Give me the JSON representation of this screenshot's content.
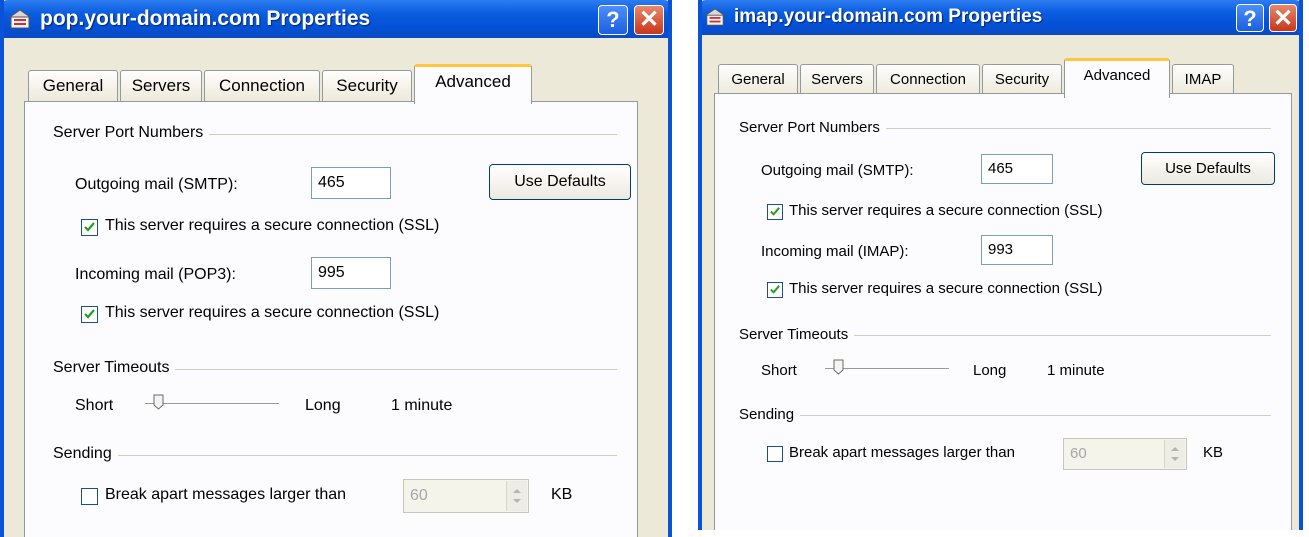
{
  "pop": {
    "title": "pop.your-domain.com Properties",
    "tabs": [
      "General",
      "Servers",
      "Connection",
      "Security",
      "Advanced"
    ],
    "active_tab": "Advanced",
    "ports_group": "Server Port Numbers",
    "outgoing_label": "Outgoing mail (SMTP):",
    "outgoing_value": "465",
    "use_defaults": "Use Defaults",
    "ssl_outgoing_label": "This server requires a secure connection (SSL)",
    "ssl_outgoing_checked": true,
    "incoming_label": "Incoming mail (POP3):",
    "incoming_value": "995",
    "ssl_incoming_label": "This server requires a secure connection (SSL)",
    "ssl_incoming_checked": true,
    "timeouts_group": "Server Timeouts",
    "short_label": "Short",
    "long_label": "Long",
    "timeout_value": "1 minute",
    "sending_group": "Sending",
    "break_label": "Break apart messages larger than",
    "break_checked": false,
    "break_value": "60",
    "kb_label": "KB"
  },
  "imap": {
    "title": "imap.your-domain.com Properties",
    "tabs": [
      "General",
      "Servers",
      "Connection",
      "Security",
      "Advanced",
      "IMAP"
    ],
    "active_tab": "Advanced",
    "ports_group": "Server Port Numbers",
    "outgoing_label": "Outgoing mail (SMTP):",
    "outgoing_value": "465",
    "use_defaults": "Use Defaults",
    "ssl_outgoing_label": "This server requires a secure connection (SSL)",
    "ssl_outgoing_checked": true,
    "incoming_label": "Incoming mail (IMAP):",
    "incoming_value": "993",
    "ssl_incoming_label": "This server requires a secure connection (SSL)",
    "ssl_incoming_checked": true,
    "timeouts_group": "Server Timeouts",
    "short_label": "Short",
    "long_label": "Long",
    "timeout_value": "1 minute",
    "sending_group": "Sending",
    "break_label": "Break apart messages larger than",
    "break_checked": false,
    "break_value": "60",
    "kb_label": "KB"
  },
  "icons": {
    "app": "mail-server-icon",
    "help": "help-icon",
    "close": "close-icon",
    "check": "checkmark-icon",
    "spinner": "spin-arrows-icon"
  },
  "colors": {
    "titlebar": "#0a5de0",
    "active_tab_accent": "#ffc83c",
    "dialog_bg": "#ece9d8"
  }
}
